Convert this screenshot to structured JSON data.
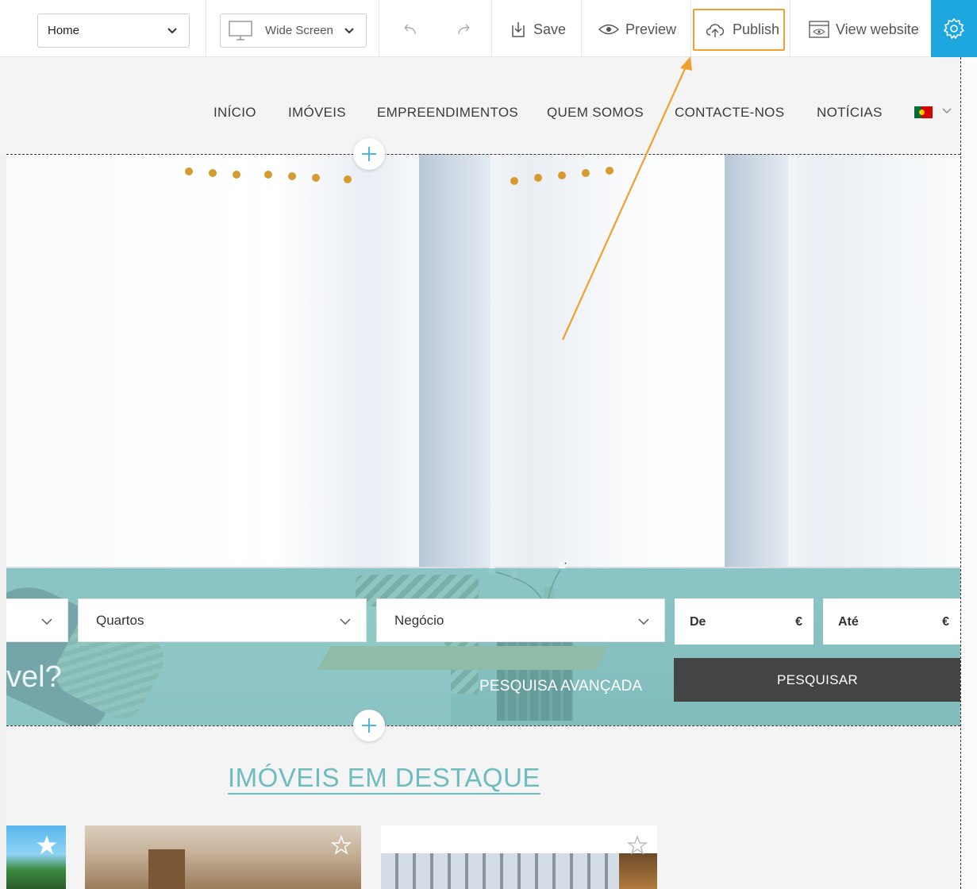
{
  "toolbar": {
    "page_select": "Home",
    "view_select": "Wide Screen",
    "undo_icon": "undo-icon",
    "redo_icon": "redo-icon",
    "save_label": "Save",
    "preview_label": "Preview",
    "publish_label": "Publish",
    "view_website_label": "View website",
    "settings_icon": "gear-icon",
    "highlight_color": "#f0a030",
    "accent_color": "#1ea7df"
  },
  "site_nav": {
    "items": [
      "INÍCIO",
      "IMÓVEIS",
      "EMPREENDIMENTOS",
      "QUEM SOMOS",
      "CONTACTE-NOS",
      "NOTÍCIAS"
    ],
    "language_flag": "portugal-flag-icon"
  },
  "search": {
    "fields": [
      "",
      "Quartos",
      "Negócio"
    ],
    "price_from": "De",
    "price_to": "Até",
    "currency": "€",
    "headline_fragment": "vel?",
    "advanced_label": "PESQUISA AVANÇADA",
    "submit_label": "PESQUISAR",
    "band_color": "#76bebc"
  },
  "featured": {
    "title": "IMÓVEIS EM DESTAQUE",
    "title_color": "#6dbcc0"
  }
}
